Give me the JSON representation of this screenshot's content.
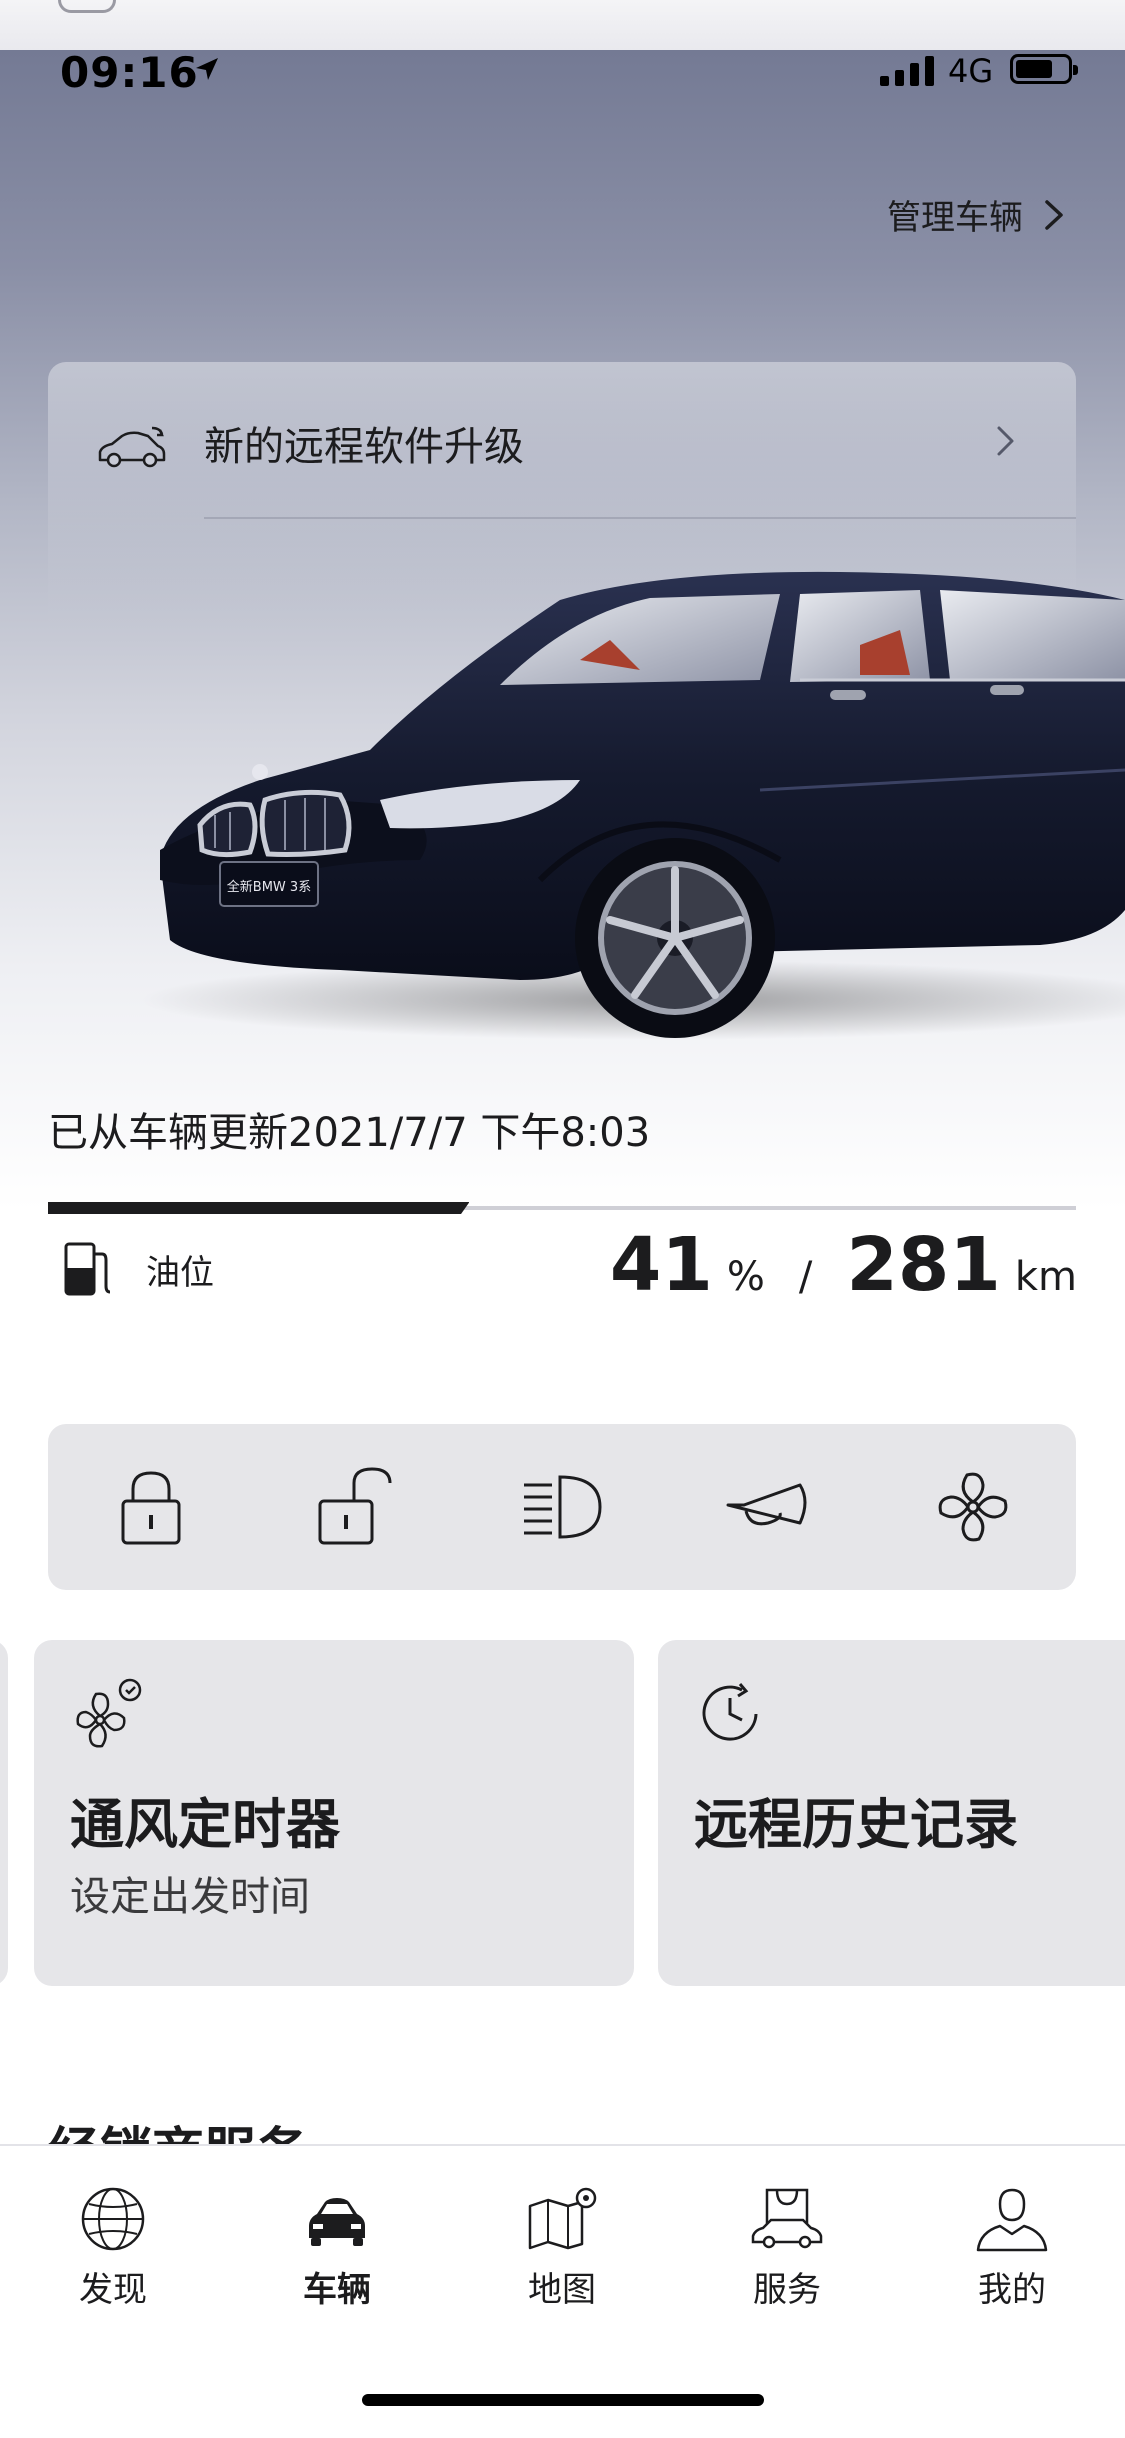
{
  "status_bar": {
    "time": "09:16",
    "network": "4G",
    "battery_level": 0.78
  },
  "header": {
    "manage_label": "管理车辆"
  },
  "notice": {
    "label": "新的远程软件升级"
  },
  "car": {
    "plate_text": "全新BMW 3系"
  },
  "vehicle": {
    "updated_text": "已从车辆更新2021/7/7 下午8:03",
    "fuel": {
      "label": "油位",
      "percent": "41",
      "percent_unit": "%",
      "separator": "/",
      "range": "281",
      "range_unit": "km",
      "level": 0.41
    }
  },
  "quick_actions": [
    {
      "name": "lock",
      "icon": "lock-closed-icon"
    },
    {
      "name": "unlock",
      "icon": "lock-open-icon"
    },
    {
      "name": "headlight",
      "icon": "headlight-icon"
    },
    {
      "name": "horn",
      "icon": "horn-icon"
    },
    {
      "name": "ventilation",
      "icon": "fan-icon"
    }
  ],
  "cards": [
    {
      "title": "通风定时器",
      "subtitle": "设定出发时间",
      "icon": "fan-timer-icon"
    },
    {
      "title": "远程历史记录",
      "icon": "clock-history-icon"
    }
  ],
  "section": {
    "title": "经销商服务"
  },
  "tabs": [
    {
      "label": "发现",
      "icon": "globe-icon",
      "active": false
    },
    {
      "label": "车辆",
      "icon": "car-icon",
      "active": true
    },
    {
      "label": "地图",
      "icon": "map-icon",
      "active": false
    },
    {
      "label": "服务",
      "icon": "service-bag-icon",
      "active": false
    },
    {
      "label": "我的",
      "icon": "person-icon",
      "active": false
    }
  ],
  "colors": {
    "text": "#1c1c1e",
    "card_bg": "#e6e6e9",
    "car_body": "#151a2e",
    "accent_bar": "#1c1c1e"
  }
}
